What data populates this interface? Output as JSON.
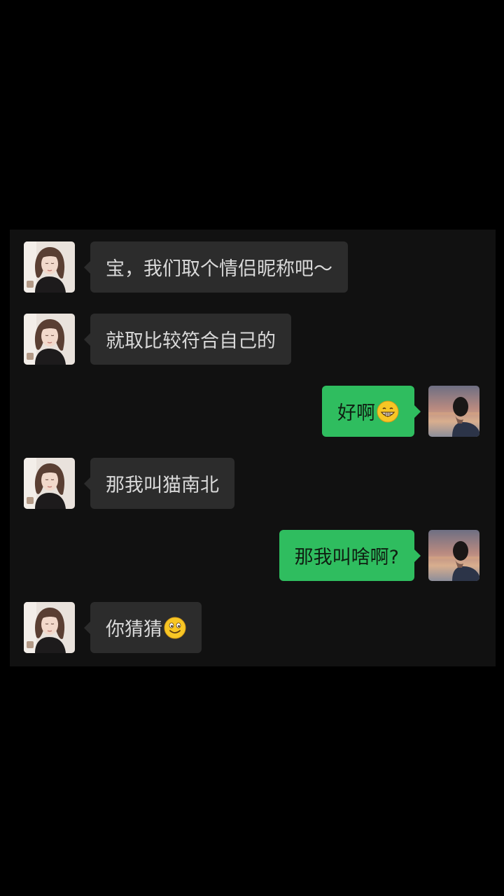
{
  "colors": {
    "background": "#000000",
    "panel": "#111111",
    "incoming_bubble": "#2c2c2c",
    "incoming_text": "#d9d9d9",
    "outgoing_bubble": "#2fbd5f",
    "outgoing_text": "#0f1f12"
  },
  "messages": [
    {
      "side": "left",
      "text": "宝，我们取个情侣昵称吧～",
      "avatar": "girl-avatar"
    },
    {
      "side": "left",
      "text": "就取比较符合自己的",
      "avatar": "girl-avatar"
    },
    {
      "side": "right",
      "text": "好啊",
      "emoji": "grinning-face-icon",
      "avatar": "boy-avatar"
    },
    {
      "side": "left",
      "text": "那我叫猫南北",
      "avatar": "girl-avatar"
    },
    {
      "side": "right",
      "text": "那我叫啥啊?",
      "avatar": "boy-avatar"
    },
    {
      "side": "left",
      "text": "你猜猜",
      "emoji": "smiling-face-icon",
      "avatar": "girl-avatar"
    }
  ]
}
